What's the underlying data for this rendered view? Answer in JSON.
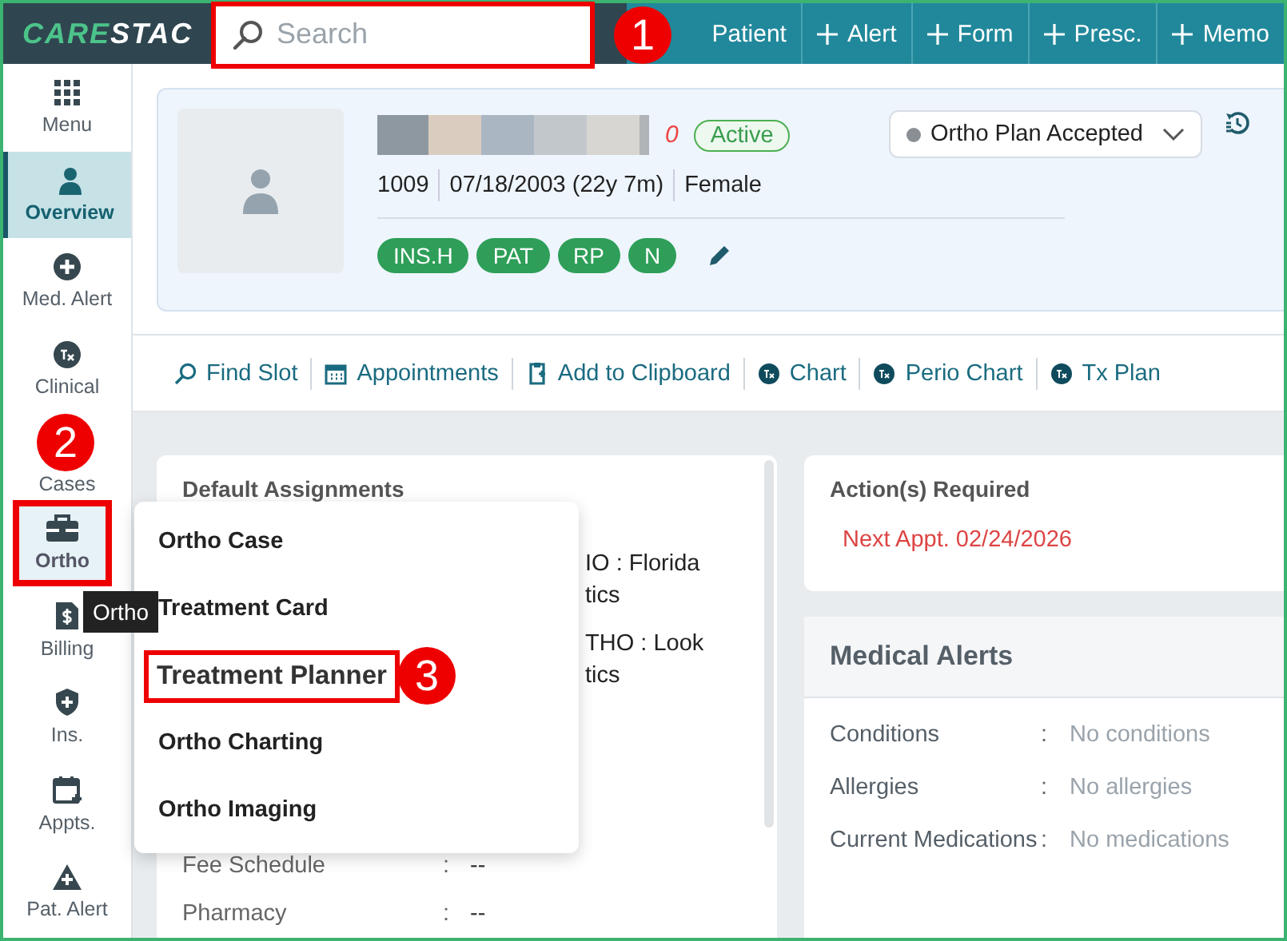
{
  "top_bar": {
    "logo": {
      "part1": "CARE",
      "part2": "STAC"
    },
    "search": {
      "placeholder": "Search",
      "highlighted": true,
      "callout": "1"
    },
    "actions": [
      {
        "label": "Patient",
        "kind": "plain"
      },
      {
        "label": "Alert",
        "kind": "add"
      },
      {
        "label": "Form",
        "kind": "add"
      },
      {
        "label": "Presc.",
        "kind": "add"
      },
      {
        "label": "Memo",
        "kind": "add"
      }
    ]
  },
  "sidebar": {
    "items": [
      {
        "label": "Menu",
        "kind": "grid",
        "selected": false,
        "highlighted": false
      },
      {
        "label": "Overview",
        "kind": "person",
        "selected": true,
        "highlighted": false
      },
      {
        "label": "Med. Alert",
        "kind": "plus",
        "selected": false,
        "highlighted": false
      },
      {
        "label": "Clinical",
        "kind": "tx",
        "selected": false,
        "highlighted": false
      },
      {
        "label": "Cases",
        "kind": "plain",
        "selected": false,
        "highlighted": false,
        "callout": "2"
      },
      {
        "label": "Ortho",
        "kind": "case",
        "selected": false,
        "highlighted": true,
        "tooltip": "Ortho"
      },
      {
        "label": "Billing",
        "kind": "bill",
        "selected": false,
        "highlighted": false
      },
      {
        "label": "Ins.",
        "kind": "shield",
        "selected": false,
        "highlighted": false
      },
      {
        "label": "Appts.",
        "kind": "calendar",
        "selected": false,
        "highlighted": false
      },
      {
        "label": "Pat. Alert",
        "kind": "warning",
        "selected": false,
        "highlighted": false
      }
    ]
  },
  "patient": {
    "flag": "0",
    "status": "Active",
    "id": "1009",
    "dob": "07/18/2003 (22y 7m)",
    "gender": "Female",
    "tags": [
      "INS.H",
      "PAT",
      "RP",
      "N"
    ],
    "plan_status": "Ortho Plan Accepted"
  },
  "toolbar": [
    {
      "label": "Find Slot",
      "kind": "search"
    },
    {
      "label": "Appointments",
      "kind": "calendar"
    },
    {
      "label": "Add to Clipboard",
      "kind": "clipboard"
    },
    {
      "label": "Chart",
      "kind": "tx"
    },
    {
      "label": "Perio Chart",
      "kind": "tx"
    },
    {
      "label": "Tx Plan",
      "kind": "tx"
    }
  ],
  "assignments": {
    "title": "Default Assignments",
    "partial_rows": [
      {
        "lines": [
          "IO : Florida",
          "tics"
        ]
      },
      {
        "lines": [
          "THO : Look",
          "tics"
        ]
      }
    ],
    "rows": [
      {
        "label": "Fee Schedule",
        "separator": ":",
        "value": "--"
      },
      {
        "label": "Pharmacy",
        "separator": ":",
        "value": "--"
      }
    ]
  },
  "actions_required": {
    "title": "Action(s) Required",
    "items": [
      "Next Appt. 02/24/2026"
    ]
  },
  "medical_alerts": {
    "title": "Medical Alerts",
    "rows": [
      {
        "label": "Conditions",
        "separator": ":",
        "value": "No conditions"
      },
      {
        "label": "Allergies",
        "separator": ":",
        "value": "No allergies"
      },
      {
        "label": "Current Medications",
        "separator": ":",
        "value": "No medications"
      }
    ]
  },
  "ortho_menu": {
    "items": [
      {
        "label": "Ortho Case",
        "highlighted": false
      },
      {
        "label": "Treatment Card",
        "highlighted": false
      },
      {
        "label": "Treatment Planner",
        "highlighted": true,
        "callout": "3"
      },
      {
        "label": "Ortho Charting",
        "highlighted": false
      },
      {
        "label": "Ortho Imaging",
        "highlighted": false
      }
    ]
  }
}
